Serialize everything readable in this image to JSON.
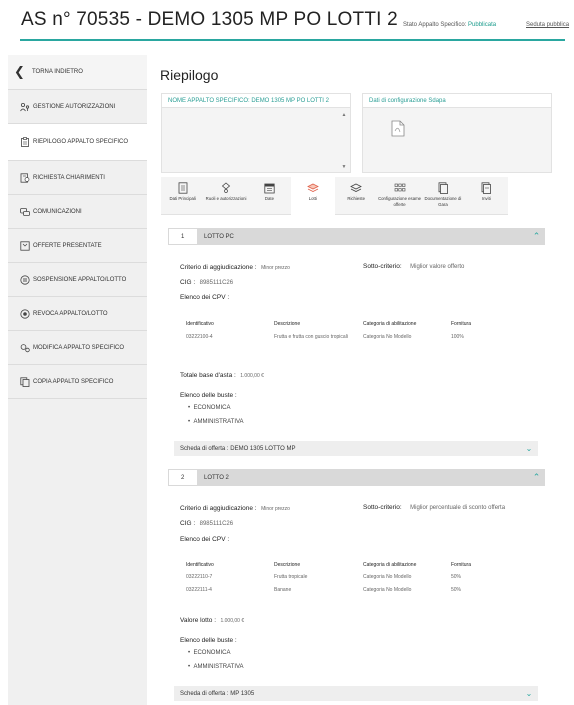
{
  "header": {
    "title": "AS n° 70535 - DEMO 1305 MP PO LOTTI 2",
    "status_label": "Stato Appalto Specifico: ",
    "status_value": "Pubblicata",
    "seduta_link": "Seduta pubblica"
  },
  "sidebar": {
    "back": "TORNA INDIETRO",
    "items": [
      {
        "label": "GESTIONE AUTORIZZAZIONI",
        "icon": "people-key-icon"
      },
      {
        "label": "RIEPILOGO APPALTO SPECIFICO",
        "icon": "clipboard-icon"
      },
      {
        "label": "RICHIESTA CHIARIMENTI",
        "icon": "document-question-icon"
      },
      {
        "label": "COMUNICAZIONI",
        "icon": "chat-icon"
      },
      {
        "label": "OFFERTE PRESENTATE",
        "icon": "offer-icon"
      },
      {
        "label": "SOSPENSIONE APPALTO/LOTTO",
        "icon": "pause-icon"
      },
      {
        "label": "REVOCA APPALTO/LOTTO",
        "icon": "revoke-icon"
      },
      {
        "label": "MODIFICA APPALTO SPECIFICO",
        "icon": "edit-gears-icon"
      },
      {
        "label": "COPIA APPALTO SPECIFICO",
        "icon": "copy-icon"
      }
    ]
  },
  "main": {
    "title": "Riepilogo",
    "card1_header": "NOME APPALTO SPECIFICO: DEMO 1305 MP PO LOTTI 2",
    "card2_header": "Dati di configurazione Sdapa",
    "tabs": [
      {
        "label": "Dati Principali",
        "icon": "document-icon"
      },
      {
        "label": "Ruoli e autorizzazioni",
        "icon": "roles-icon"
      },
      {
        "label": "Date",
        "icon": "calendar-icon"
      },
      {
        "label": "Lotti",
        "icon": "layers-icon"
      },
      {
        "label": "Richieste",
        "icon": "stack-icon"
      },
      {
        "label": "Configurazione esame offerte",
        "icon": "grid-icon"
      },
      {
        "label": "Documentazione di Gara",
        "icon": "docs-icon"
      },
      {
        "label": "Inviti",
        "icon": "invite-icon"
      }
    ]
  },
  "lotti": [
    {
      "num": "1",
      "name": "LOTTO PC",
      "criterio_label": "Criterio di aggiudicazione :",
      "criterio_value": "Minor prezzo",
      "sotto_label": "Sotto-criterio:",
      "sotto_value": "Miglior valore offerto",
      "cig_label": "CIG :",
      "cig_value": "8985111C26",
      "cpv_title": "Elenco dei CPV :",
      "cpv_headers": [
        "Identificativo",
        "Descrizione",
        "Categoria di abilitazione",
        "Fornitura"
      ],
      "cpv_rows": [
        [
          "03222100-4",
          "Frutta e frutta con guscio tropicali",
          "Categoria No Modello",
          "100%"
        ]
      ],
      "base_label": "Totale base d'asta :",
      "base_value": "1.000,00 €",
      "buste_title": "Elenco delle buste :",
      "buste": [
        "ECONOMICA",
        "AMMINISTRATIVA"
      ],
      "scheda_label": "Scheda di offerta :",
      "scheda_value": "DEMO 1305 LOTTO MP"
    },
    {
      "num": "2",
      "name": "LOTTO 2",
      "criterio_label": "Criterio di aggiudicazione :",
      "criterio_value": "Minor prezzo",
      "sotto_label": "Sotto-criterio:",
      "sotto_value": "Miglior percentuale di sconto offerta",
      "cig_label": "CIG :",
      "cig_value": "8985111C26",
      "cpv_title": "Elenco dei CPV :",
      "cpv_headers": [
        "Identificativo",
        "Descrizione",
        "Categoria di abilitazione",
        "Fornitura"
      ],
      "cpv_rows": [
        [
          "03222110-7",
          "Frutta tropicale",
          "Categoria No Modello",
          "50%"
        ],
        [
          "03222111-4",
          "Banane",
          "Categoria No Modello",
          "50%"
        ]
      ],
      "base_label": "Valore lotto :",
      "base_value": "1.000,00 €",
      "buste_title": "Elenco delle buste :",
      "buste": [
        "ECONOMICA",
        "AMMINISTRATIVA"
      ],
      "scheda_label": "Scheda di offerta :",
      "scheda_value": "MP 1305"
    }
  ],
  "colors": {
    "accent": "#2aa7a0",
    "status": "#1a9b8c"
  }
}
